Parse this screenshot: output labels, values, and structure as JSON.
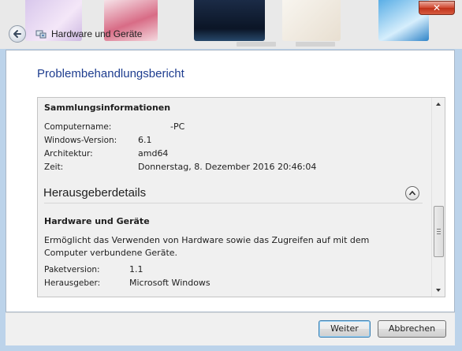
{
  "window": {
    "title": "Hardware und Geräte",
    "close_glyph": "✕"
  },
  "page": {
    "heading": "Problembehandlungsbericht"
  },
  "collection": {
    "title": "Sammlungsinformationen",
    "rows": [
      {
        "key": "Computername:",
        "value": "-PC"
      },
      {
        "key": "Windows-Version:",
        "value": "6.1"
      },
      {
        "key": "Architektur:",
        "value": "amd64"
      },
      {
        "key": "Zeit:",
        "value": "Donnerstag, 8. Dezember 2016 20:46:04"
      }
    ]
  },
  "publisher": {
    "section_title": "Herausgeberdetails",
    "package_title": "Hardware und Geräte",
    "description": "Ermöglicht das Verwenden von Hardware sowie das Zugreifen auf mit dem Computer verbundene Geräte.",
    "rows": [
      {
        "key": "Paketversion:",
        "value": "1.1"
      },
      {
        "key": "Herausgeber:",
        "value": "Microsoft Windows"
      }
    ]
  },
  "buttons": {
    "next": "Weiter",
    "cancel": "Abbrechen"
  },
  "colors": {
    "heading": "#1e3d8f",
    "close": "#c0321a",
    "default_button_border": "#3c7fb1"
  },
  "icons": [
    "back-arrow-icon",
    "hardware-devices-icon",
    "close-icon",
    "collapse-chevron-icon",
    "scroll-up-icon",
    "scroll-down-icon"
  ]
}
